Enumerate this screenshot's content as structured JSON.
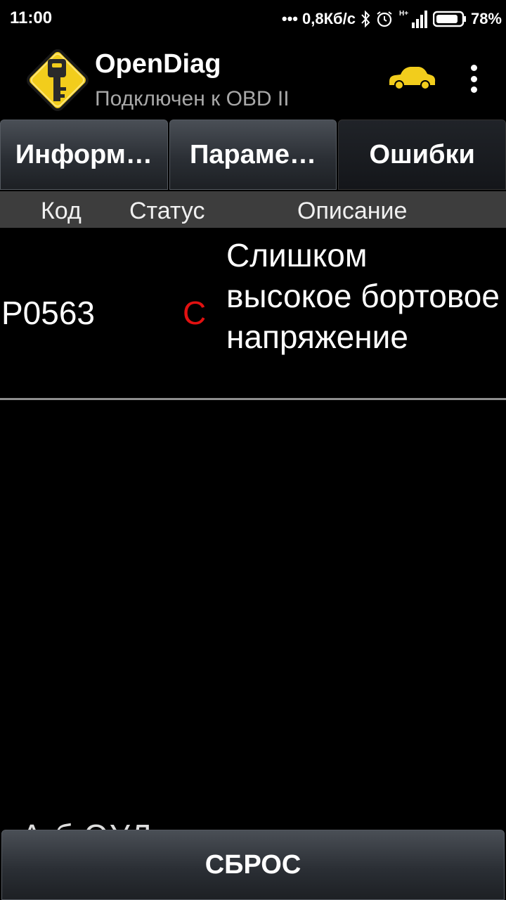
{
  "status_bar": {
    "time": "11:00",
    "network_speed": "0,8Кб/с",
    "network_type": "H+",
    "battery": "78%"
  },
  "app": {
    "title": "OpenDiag",
    "subtitle": "Подключен к OBD II",
    "accent_color": "#f2cd1c"
  },
  "tabs": [
    {
      "label": "Информ…",
      "active": false
    },
    {
      "label": "Параме…",
      "active": false
    },
    {
      "label": "Ошибки",
      "active": true
    }
  ],
  "table": {
    "headers": {
      "code": "Код",
      "status": "Статус",
      "description": "Описание"
    },
    "rows": [
      {
        "code": "P0563",
        "status": "C",
        "description": "Слишком высокое бортовое напряжение",
        "status_color": "#e21111"
      }
    ]
  },
  "partial_text": "А          б      ЭУЛ",
  "reset_button": {
    "label": "СБРОС"
  }
}
